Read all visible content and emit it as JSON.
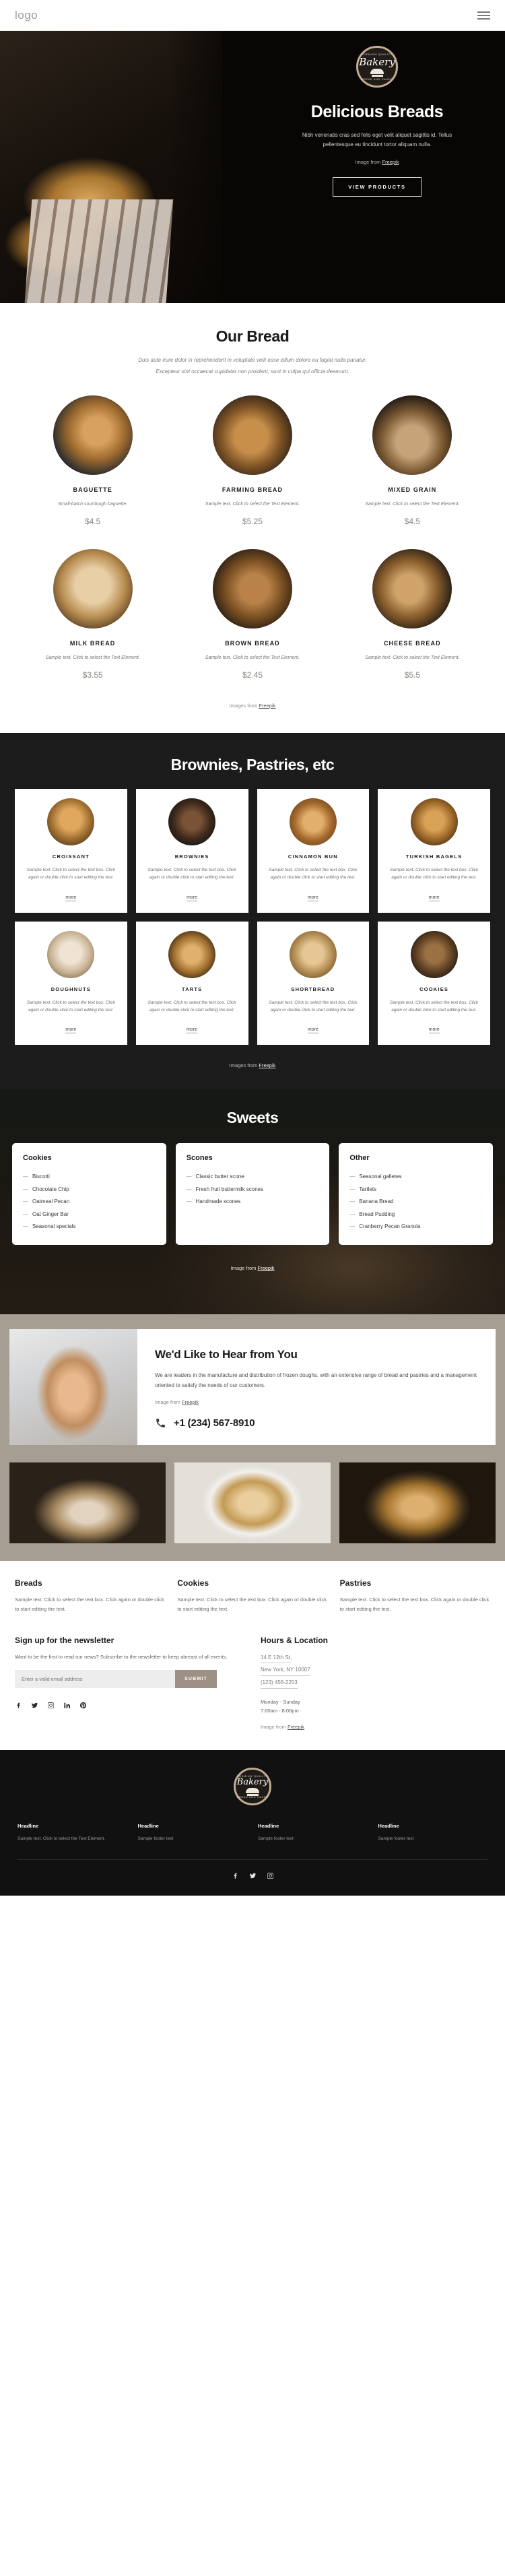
{
  "nav": {
    "logo": "logo",
    "menu_icon": "hamburger-icon"
  },
  "hero": {
    "badge": {
      "top": "Premium Quality",
      "name": "Bakery",
      "bottom": "Bread and Cakes"
    },
    "title": "Delicious Breads",
    "paragraph": "Nibh venenatis cras sed felis eget velit aliquet sagittis id. Tellus pellentesque eu tincidunt tortor aliquam nulla.",
    "credit_prefix": "Image from ",
    "credit_link": "Freepik",
    "cta": "VIEW PRODUCTS"
  },
  "bread": {
    "title": "Our Bread",
    "subtitle_line1": "Duis aute irure dolor in reprehenderit in voluptate velit esse cillum dolore eu fugiat nulla pariatur.",
    "subtitle_line2": "Excepteur sint occaecat cupidatat non proident, sunt in culpa qui officia deserunt.",
    "items": [
      {
        "name": "BAGUETTE",
        "desc": "Small-batch sourdough baguette.",
        "price": "$4.5",
        "img": "c-baguette"
      },
      {
        "name": "FARMING BREAD",
        "desc": "Sample text. Click to select the Text Element.",
        "price": "$5.25",
        "img": "c-farming"
      },
      {
        "name": "MIXED GRAIN",
        "desc": "Sample text. Click to select the Text Element.",
        "price": "$4.5",
        "img": "c-mixed"
      },
      {
        "name": "MILK BREAD",
        "desc": "Sample text. Click to select the Text Element.",
        "price": "$3.55",
        "img": "c-milk"
      },
      {
        "name": "BROWN BREAD",
        "desc": "Sample text. Click to select the Text Element.",
        "price": "$2.45",
        "img": "c-brown"
      },
      {
        "name": "CHEESE BREAD",
        "desc": "Sample text. Click to select the Text Element.",
        "price": "$5.5",
        "img": "c-cheese"
      }
    ],
    "credit_prefix": "Images from ",
    "credit_link": "Freepik"
  },
  "pastries": {
    "title": "Brownies, Pastries, etc",
    "sample_desc": "Sample text. Click to select the text box. Click again or double click to start editing the text.",
    "more": "more",
    "items": [
      {
        "name": "CROISSANT",
        "img": "p-crois"
      },
      {
        "name": "BROWNIES",
        "img": "p-brown"
      },
      {
        "name": "CINNAMON BUN",
        "img": "p-cinn"
      },
      {
        "name": "TURKISH BAGELS",
        "img": "p-turk"
      },
      {
        "name": "DOUGHNUTS",
        "img": "p-dough"
      },
      {
        "name": "TARTS",
        "img": "p-tarts"
      },
      {
        "name": "SHORTBREAD",
        "img": "p-short"
      },
      {
        "name": "COOKIES",
        "img": "p-cook"
      }
    ],
    "credit_prefix": "Images from ",
    "credit_link": "Freepik"
  },
  "sweets": {
    "title": "Sweets",
    "columns": [
      {
        "heading": "Cookies",
        "items": [
          "Biscotti",
          "Chocolate Chip",
          "Oatmeal Pecan",
          "Oat Ginger Bar",
          "Seasonal specials"
        ]
      },
      {
        "heading": "Scones",
        "items": [
          "Classic butter scone",
          "Fresh fruit buttermilk scones",
          "Handmade scones"
        ]
      },
      {
        "heading": "Other",
        "items": [
          "Seasonal galletes",
          "Tartlets",
          "Banana Bread",
          "Bread Pudding",
          "Cranberry Pecan Granola"
        ]
      }
    ],
    "credit_prefix": "Image from ",
    "credit_link": "Freepik"
  },
  "contact": {
    "title": "We'd Like to Hear from You",
    "paragraph": "We are leaders in the manufacture and distribution of frozen doughs, with an extensive range of bread and pastries and a management oriented to satisfy the needs of our customers.",
    "credit_prefix": "Image from ",
    "credit_link": "Freepik",
    "phone_icon": "phone-icon",
    "phone": "+1 (234) 567-8910"
  },
  "info": {
    "sample_desc": "Sample text. Click to select the text box. Click again or double click to start editing the text.",
    "cards": [
      {
        "title": "Breads"
      },
      {
        "title": "Cookies"
      },
      {
        "title": "Pastries"
      }
    ]
  },
  "newsletter": {
    "title": "Sign up for the newsletter",
    "paragraph": "Want to be the first to read our news? Subscribe to the newsletter to keep abreast of all events.",
    "placeholder": "Enter a valid email address",
    "value": "",
    "submit": "SUBMIT",
    "social": [
      "facebook-icon",
      "twitter-icon",
      "instagram-icon",
      "linkedin-icon",
      "pinterest-icon"
    ]
  },
  "hours": {
    "title": "Hours & Location",
    "address_line1": "14 E 12th St,",
    "address_line2": "New York, NY 10007",
    "phone": "(123) 456-2253",
    "days": "Monday - Sunday",
    "time": "7:00am - 8:00pm",
    "credit_prefix": "Image from ",
    "credit_link": "Freepik"
  },
  "footer": {
    "badge": {
      "top": "Premium Quality",
      "name": "Bakery",
      "bottom": "Bread and Cakes"
    },
    "columns": [
      {
        "heading": "Headline",
        "text": "Sample text. Click to select the Text Element."
      },
      {
        "heading": "Headline",
        "text": "Sample footer text"
      },
      {
        "heading": "Headline",
        "text": "Sample footer text"
      },
      {
        "heading": "Headline",
        "text": "Sample footer text"
      }
    ],
    "social": [
      "facebook-icon",
      "twitter-icon",
      "instagram-icon"
    ]
  }
}
